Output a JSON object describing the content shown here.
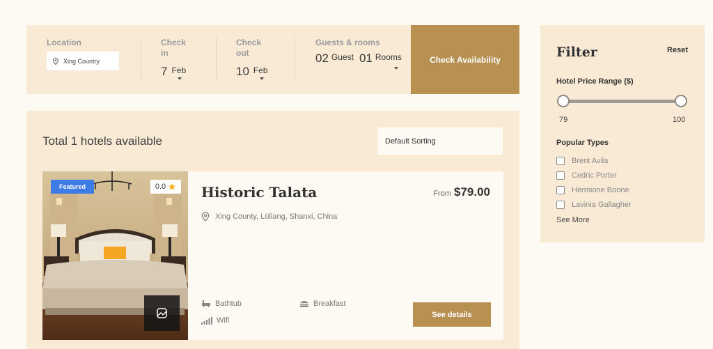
{
  "search": {
    "location_label": "Location",
    "location_value": "Xing Country",
    "checkin_label": "Check in",
    "checkin_day": "7",
    "checkin_month": "Feb",
    "checkout_label": "Check out",
    "checkout_day": "10",
    "checkout_month": "Feb",
    "guests_label": "Guests & rooms",
    "guest_count": "02",
    "guest_word": "Guest",
    "room_count": "01",
    "room_word": "Rooms",
    "check_button": "Check Availability"
  },
  "results": {
    "total_text": "Total 1 hotels available",
    "sorting": "Default Sorting"
  },
  "hotel": {
    "badge": "Featured",
    "rating": "0.0",
    "name": "Historic Talata",
    "price_prefix": "From",
    "price": "$79.00",
    "address": "Xing County, Lüliang, Shanxi, China",
    "amenities": [
      "Bathtub",
      "Breakfast",
      "Wifi"
    ],
    "details_button": "See details"
  },
  "filter": {
    "title": "Filter",
    "reset": "Reset",
    "price_label": "Hotel Price Range ($)",
    "price_min": "79",
    "price_max": "100",
    "popular_label": "Popular Types",
    "types": [
      "Brent Avila",
      "Cedric Porter",
      "Hermione Boone",
      "Lavinia Gallagher"
    ],
    "see_more": "See More"
  },
  "colors": {
    "accent": "#b89052",
    "panel": "#f9ead6",
    "background": "#fdf9f3",
    "badge": "#3d7be6"
  }
}
